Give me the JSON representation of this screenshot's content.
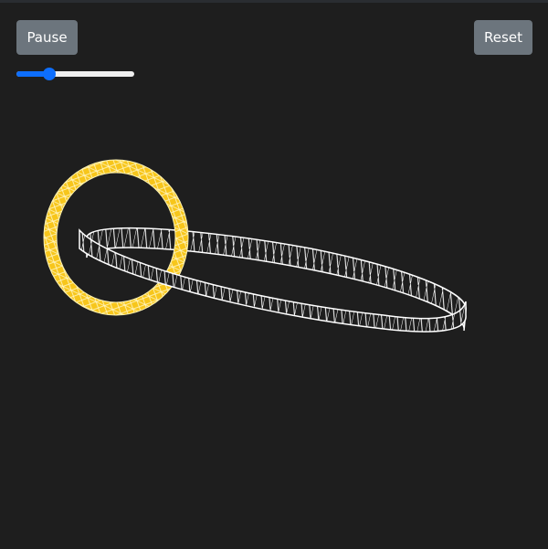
{
  "controls": {
    "pause_label": "Pause",
    "reset_label": "Reset",
    "speed_slider": {
      "value": 0.25
    }
  },
  "scene": {
    "background": "#1e1e1e",
    "objects": [
      {
        "name": "gold-ring",
        "color": "#f5c518",
        "wire": "#ffffff"
      },
      {
        "name": "white-band",
        "color": "#ffffff",
        "wire": "#3a3a3a"
      }
    ]
  }
}
